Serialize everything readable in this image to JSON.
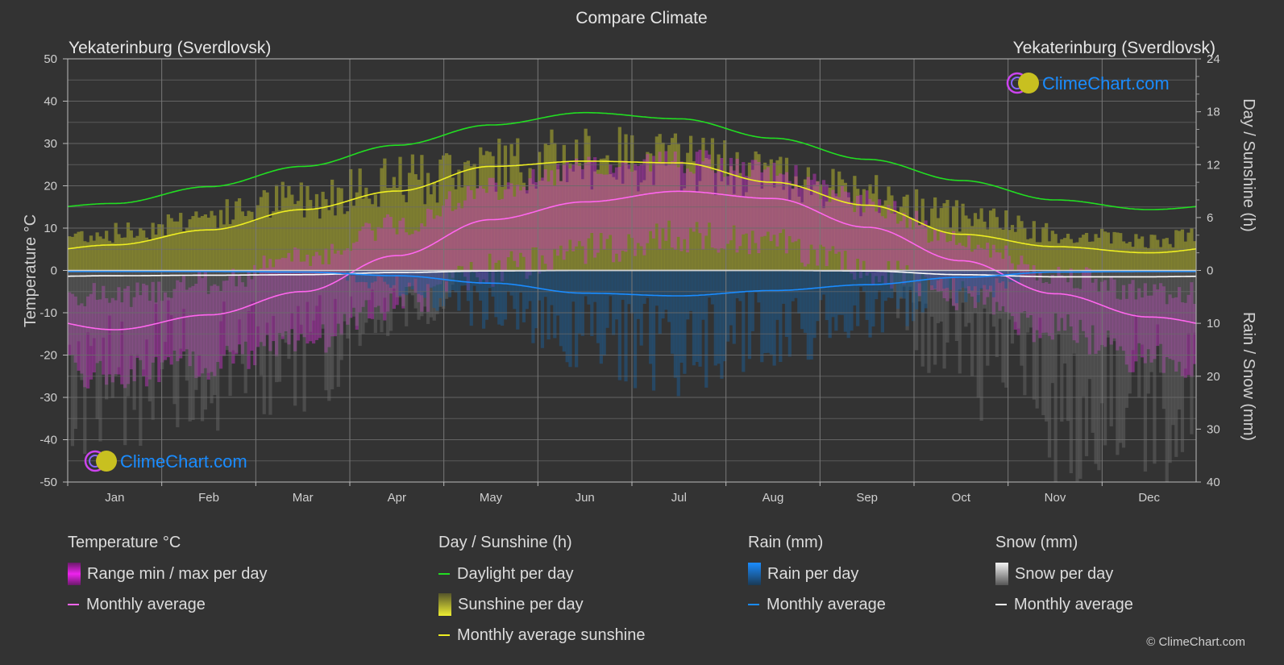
{
  "page": {
    "title": "Compare Climate",
    "location_left": "Yekaterinburg (Sverdlovsk)",
    "location_right": "Yekaterinburg (Sverdlovsk)",
    "brand": "ClimeChart.com",
    "copyright": "© ClimeChart.com"
  },
  "legend": {
    "temperature": {
      "header": "Temperature °C",
      "range_label": "Range min / max per day",
      "avg_label": "Monthly average"
    },
    "sunshine": {
      "header": "Day / Sunshine (h)",
      "daylight_label": "Daylight per day",
      "sunshine_label": "Sunshine per day",
      "avg_label": "Monthly average sunshine"
    },
    "rain": {
      "header": "Rain (mm)",
      "per_day_label": "Rain per day",
      "avg_label": "Monthly average"
    },
    "snow": {
      "header": "Snow (mm)",
      "per_day_label": "Snow per day",
      "avg_label": "Monthly average"
    }
  },
  "colors": {
    "background": "#333333",
    "grid": "#5a5a5a",
    "temp_avg": "#ff66ee",
    "temp_range": "#cc33cc",
    "daylight": "#22dd22",
    "sunshine_avg": "#eeee22",
    "sunshine_bar": "#8c8c30",
    "rain_avg": "#1a8cff",
    "rain_bar": "#1e5a8c",
    "snow_avg": "#ffffff",
    "snow_bar": "#7a7a7a",
    "brand_text": "#1a8cff"
  },
  "chart_data": {
    "type": "line",
    "title": "Compare Climate",
    "categories": [
      "Jan",
      "Feb",
      "Mar",
      "Apr",
      "May",
      "Jun",
      "Jul",
      "Aug",
      "Sep",
      "Oct",
      "Nov",
      "Dec"
    ],
    "y_left": {
      "label": "Temperature °C",
      "range": [
        -50,
        50
      ],
      "ticks": [
        50,
        40,
        30,
        20,
        10,
        0,
        -10,
        -20,
        -30,
        -40,
        -50
      ]
    },
    "y_right_top": {
      "label": "Day / Sunshine (h)",
      "range": [
        0,
        24
      ],
      "ticks": [
        24,
        18,
        12,
        6,
        0
      ]
    },
    "y_right_bottom": {
      "label": "Rain / Snow (mm)",
      "range": [
        0,
        40
      ],
      "ticks": [
        0,
        10,
        20,
        30,
        40
      ]
    },
    "grid": true,
    "series": [
      {
        "name": "Temperature monthly average",
        "axis": "temperature",
        "values": [
          -14,
          -10.5,
          -5,
          3.5,
          12,
          16.2,
          18.7,
          17,
          10.2,
          2.3,
          -5.5,
          -11
        ]
      },
      {
        "name": "Temperature daily max (approx)",
        "axis": "temperature",
        "values": [
          -6,
          -3,
          3,
          11,
          19,
          24,
          26,
          23,
          16,
          7,
          -1,
          -5
        ]
      },
      {
        "name": "Temperature daily min (approx)",
        "axis": "temperature",
        "values": [
          -21,
          -18,
          -13,
          -4,
          4,
          9,
          12,
          10,
          4,
          -2,
          -10,
          -17
        ]
      },
      {
        "name": "Daylight per day",
        "axis": "hours",
        "values": [
          7.6,
          9.5,
          11.8,
          14.2,
          16.5,
          17.9,
          17.2,
          15.0,
          12.6,
          10.2,
          8.0,
          6.9
        ]
      },
      {
        "name": "Sunshine per day (max band)",
        "axis": "hours",
        "values": [
          5.5,
          8,
          10.5,
          13,
          15.5,
          16.5,
          16,
          14,
          11,
          8,
          5.5,
          4.5
        ]
      },
      {
        "name": "Monthly average sunshine",
        "axis": "hours",
        "values": [
          2.9,
          4.6,
          6.9,
          9.0,
          11.8,
          12.4,
          12.2,
          10.0,
          7.4,
          4.1,
          2.7,
          2.0
        ]
      },
      {
        "name": "Rain monthly average",
        "axis": "precip",
        "values": [
          0.2,
          0.2,
          0.3,
          1.0,
          2.4,
          4.3,
          4.8,
          3.8,
          2.7,
          1.3,
          0.3,
          0.2
        ]
      },
      {
        "name": "Snow monthly average",
        "axis": "precip",
        "values": [
          1.0,
          0.9,
          0.8,
          0.4,
          0.1,
          0,
          0,
          0,
          0.1,
          0.8,
          1.2,
          1.2
        ]
      }
    ]
  }
}
